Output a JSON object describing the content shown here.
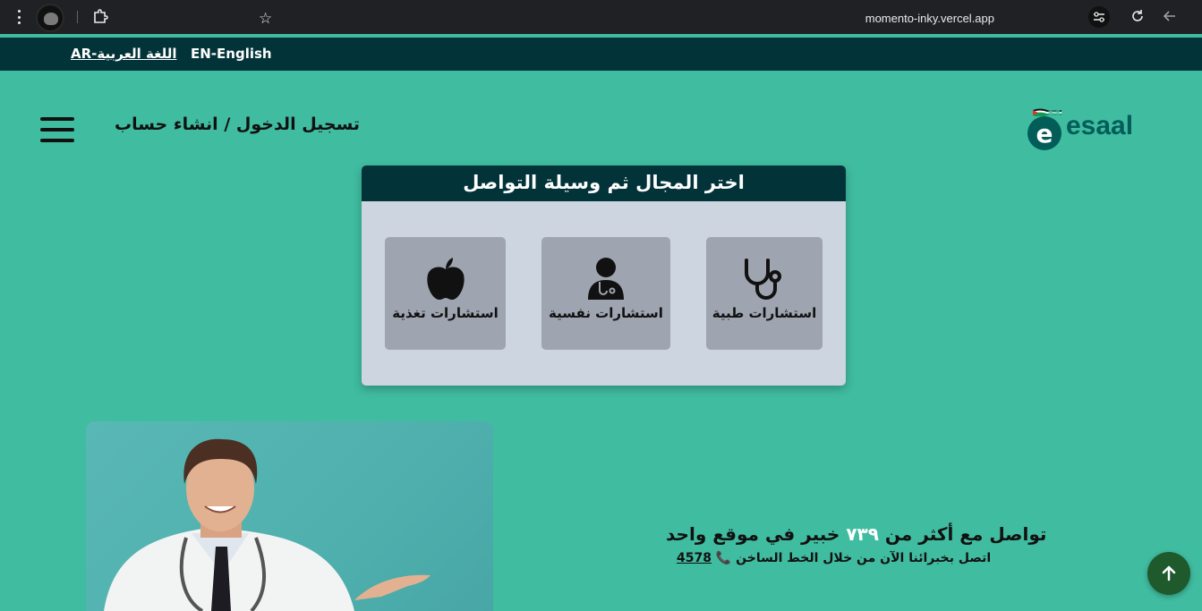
{
  "browser": {
    "url": "momento-inky.vercel.app"
  },
  "language_bar": {
    "arabic": "AR-اللغة العربية",
    "english": "EN-English"
  },
  "header": {
    "login_link": "تسجيل الدخول / انشاء حساب",
    "logo_text": "esaal",
    "logo_letter": "e"
  },
  "selection_card": {
    "title": "اختر المجال ثم وسيلة التواصل",
    "options": [
      {
        "label": "استشارات طبية",
        "icon": "stethoscope-icon"
      },
      {
        "label": "استشارات نفسية",
        "icon": "doctor-icon"
      },
      {
        "label": "استشارات تغذية",
        "icon": "apple-icon"
      }
    ]
  },
  "info": {
    "line1_before": "تواصل مع أكثر من",
    "expert_count": "٧٣٩",
    "line1_after": "خبير في موقع واحد",
    "line2": "اتصل بخبرائنا الآن من خلال الخط الساخن",
    "hotline": "4578"
  },
  "colors": {
    "background": "#40bca0",
    "dark_teal": "#023338",
    "card": "#cdd5e1",
    "tile": "#9ea4b0",
    "scroll_button": "#1e5a2b"
  }
}
